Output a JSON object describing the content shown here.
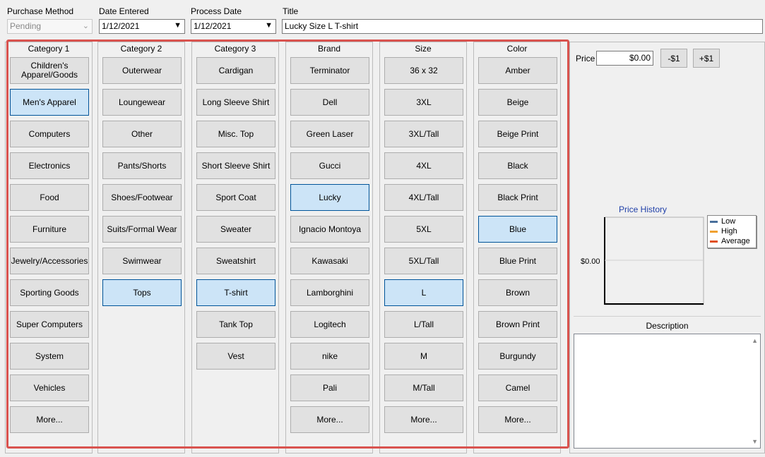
{
  "header": {
    "purchase_method": {
      "label": "Purchase Method",
      "value": "Pending"
    },
    "date_entered": {
      "label": "Date Entered",
      "value": "1/12/2021"
    },
    "process_date": {
      "label": "Process Date",
      "value": "1/12/2021"
    },
    "title": {
      "label": "Title",
      "value": "Lucky Size L T-shirt"
    }
  },
  "columns": [
    {
      "title": "Category 1",
      "selected": "Men's Apparel",
      "items": [
        "Children's Apparel/Goods",
        "Men's Apparel",
        "Computers",
        "Electronics",
        "Food",
        "Furniture",
        "Jewelry/Accessories",
        "Sporting Goods",
        "Super Computers",
        "System",
        "Vehicles",
        "More..."
      ]
    },
    {
      "title": "Category 2",
      "selected": "Tops",
      "items": [
        "Outerwear",
        "Loungewear",
        "Other",
        "Pants/Shorts",
        "Shoes/Footwear",
        "Suits/Formal Wear",
        "Swimwear",
        "Tops"
      ]
    },
    {
      "title": "Category 3",
      "selected": "T-shirt",
      "items": [
        "Cardigan",
        "Long Sleeve Shirt",
        "Misc. Top",
        "Short Sleeve Shirt",
        "Sport Coat",
        "Sweater",
        "Sweatshirt",
        "T-shirt",
        "Tank Top",
        "Vest"
      ]
    },
    {
      "title": "Brand",
      "selected": "Lucky",
      "items": [
        "Terminator",
        "Dell",
        "Green Laser",
        "Gucci",
        "Lucky",
        "Ignacio Montoya",
        "Kawasaki",
        "Lamborghini",
        "Logitech",
        "nike",
        "Pali",
        "More..."
      ]
    },
    {
      "title": "Size",
      "selected": "L",
      "items": [
        "36 x 32",
        "3XL",
        "3XL/Tall",
        "4XL",
        "4XL/Tall",
        "5XL",
        "5XL/Tall",
        "L",
        "L/Tall",
        "M",
        "M/Tall",
        "More..."
      ]
    },
    {
      "title": "Color",
      "selected": "Blue",
      "items": [
        "Amber",
        "Beige",
        "Beige Print",
        "Black",
        "Black Print",
        "Blue",
        "Blue Print",
        "Brown",
        "Brown Print",
        "Burgundy",
        "Camel",
        "More..."
      ]
    }
  ],
  "price": {
    "label": "Price",
    "value": "$0.00",
    "minus_label": "-$1",
    "plus_label": "+$1"
  },
  "chart_data": {
    "type": "line",
    "title": "Price History",
    "y_tick_labels": [
      "$0.00"
    ],
    "series": [
      {
        "name": "Low",
        "color": "#4a6f9b",
        "values": []
      },
      {
        "name": "High",
        "color": "#f0a030",
        "values": []
      },
      {
        "name": "Average",
        "color": "#e05020",
        "values": []
      }
    ],
    "legend_position": "right"
  },
  "description": {
    "label": "Description",
    "value": ""
  }
}
